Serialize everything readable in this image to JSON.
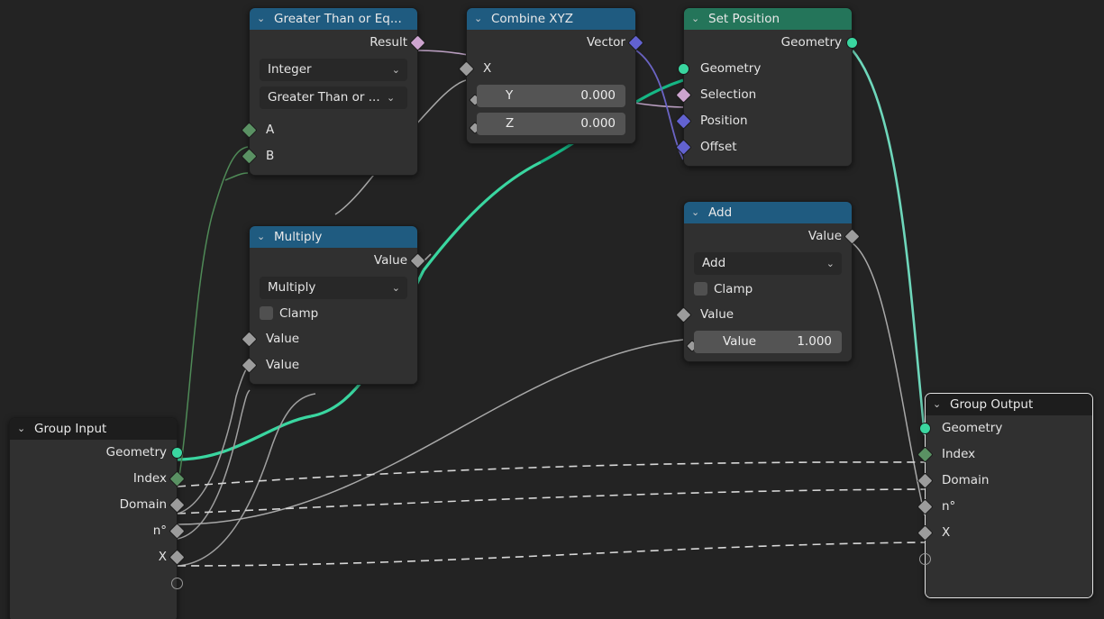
{
  "editor": {
    "background": "#232323",
    "colors": {
      "header_blue": "#1f5b80",
      "header_green": "#24755a",
      "header_dark": "#1d1d1d",
      "node_body": "#303030",
      "geometry_socket": "#3ad6a0",
      "field_green_socket": "#5a9163",
      "gray_socket": "#9c9c9c",
      "vector_socket": "#6262d0",
      "boolean_socket": "#cda4cf",
      "selected_outline": "#e3e3e3"
    }
  },
  "nodes": {
    "compare": {
      "title": "Greater Than or Eq...",
      "outputs": [
        {
          "label": "Result",
          "type": "boolean"
        }
      ],
      "widgets": [
        {
          "kind": "dropdown",
          "value": "Integer"
        },
        {
          "kind": "dropdown",
          "value": "Greater Than or ..."
        }
      ],
      "inputs": [
        {
          "label": "A",
          "type": "field-green"
        },
        {
          "label": "B",
          "type": "field-green"
        }
      ]
    },
    "combine_xyz": {
      "title": "Combine XYZ",
      "outputs": [
        {
          "label": "Vector",
          "type": "vector"
        }
      ],
      "inputs": [
        {
          "label": "X",
          "type": "gray",
          "widget": false
        },
        {
          "label": "Y",
          "type": "gray",
          "widget": true,
          "value": "0.000"
        },
        {
          "label": "Z",
          "type": "gray",
          "widget": true,
          "value": "0.000"
        }
      ]
    },
    "set_position": {
      "title": "Set Position",
      "outputs": [
        {
          "label": "Geometry",
          "type": "geometry"
        }
      ],
      "inputs": [
        {
          "label": "Geometry",
          "type": "geometry"
        },
        {
          "label": "Selection",
          "type": "boolean"
        },
        {
          "label": "Position",
          "type": "vector"
        },
        {
          "label": "Offset",
          "type": "vector"
        }
      ]
    },
    "add": {
      "title": "Add",
      "outputs": [
        {
          "label": "Value",
          "type": "gray"
        }
      ],
      "widgets": [
        {
          "kind": "dropdown",
          "value": "Add"
        }
      ],
      "checkbox": {
        "label": "Clamp",
        "checked": false
      },
      "inputs": [
        {
          "label": "Value",
          "type": "gray",
          "widget": false
        },
        {
          "label": "Value",
          "type": "gray",
          "widget": true,
          "value": "1.000"
        }
      ]
    },
    "multiply": {
      "title": "Multiply",
      "outputs": [
        {
          "label": "Value",
          "type": "gray"
        }
      ],
      "widgets": [
        {
          "kind": "dropdown",
          "value": "Multiply"
        }
      ],
      "checkbox": {
        "label": "Clamp",
        "checked": false
      },
      "inputs": [
        {
          "label": "Value",
          "type": "gray"
        },
        {
          "label": "Value",
          "type": "gray"
        }
      ]
    },
    "group_input": {
      "title": "Group Input",
      "outputs": [
        {
          "label": "Geometry",
          "type": "geometry"
        },
        {
          "label": "Index",
          "type": "field-green"
        },
        {
          "label": "Domain",
          "type": "gray"
        },
        {
          "label": "n°",
          "type": "gray"
        },
        {
          "label": "X",
          "type": "gray"
        },
        {
          "label": "",
          "type": "hollow"
        }
      ]
    },
    "group_output": {
      "title": "Group Output",
      "selected": true,
      "inputs": [
        {
          "label": "Geometry",
          "type": "geometry"
        },
        {
          "label": "Index",
          "type": "field-green"
        },
        {
          "label": "Domain",
          "type": "gray"
        },
        {
          "label": "n°",
          "type": "gray"
        },
        {
          "label": "X",
          "type": "gray"
        },
        {
          "label": "",
          "type": "hollow"
        }
      ]
    }
  },
  "icons": {
    "collapse_chevron": "⌄",
    "dropdown_chevron": "⌄"
  }
}
